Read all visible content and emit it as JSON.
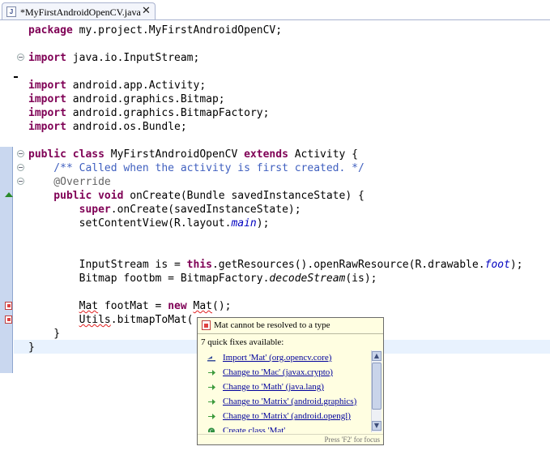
{
  "tab": {
    "title": "*MyFirstAndroidOpenCV.java",
    "close_glyph": "✕"
  },
  "code": {
    "l1": {
      "kw": "package",
      "rest": " my.project.MyFirstAndroidOpenCV;"
    },
    "l2": {
      "kw": "import",
      "rest": " java.io.InputStream;"
    },
    "l3": {
      "kw": "import",
      "rest": " android.app.Activity;"
    },
    "l4": {
      "kw": "import",
      "rest": " android.graphics.Bitmap;"
    },
    "l5": {
      "kw": "import",
      "rest": " android.graphics.BitmapFactory;"
    },
    "l6": {
      "kw": "import",
      "rest": " android.os.Bundle;"
    },
    "l7": {
      "kw1": "public class",
      "mid": " MyFirstAndroidOpenCV ",
      "kw2": "extends",
      "rest": " Activity {"
    },
    "l8": {
      "comment": "    /** Called when the activity is first created. */"
    },
    "l9": {
      "annotation": "    @Override"
    },
    "l10": {
      "kw": "    public void",
      "rest": " onCreate(Bundle savedInstanceState) {"
    },
    "l11": {
      "kw": "        super",
      "rest": ".onCreate(savedInstanceState);"
    },
    "l12": {
      "pre": "        setContentView(R.layout.",
      "field": "main",
      "post": ");"
    },
    "l13": {
      "pre": "        InputStream is = ",
      "kw": "this",
      "mid": ".getResources().openRawResource(R.drawable.",
      "field": "foot",
      "post": ");"
    },
    "l14": {
      "pre": "        Bitmap footbm = BitmapFactory.",
      "method": "decodeStream",
      "post": "(is);"
    },
    "l15": {
      "pre": "        ",
      "err1": "Mat",
      "mid": " footMat = ",
      "kw": "new",
      "sp": " ",
      "err2": "Mat",
      "post": "();"
    },
    "l16": {
      "pre": "        ",
      "err": "Utils",
      "post": ".bitmapToMat("
    },
    "l17": {
      "text": "    }"
    },
    "l18": {
      "text": "}"
    }
  },
  "popup": {
    "message": "Mat cannot be resolved to a type",
    "count": "7 quick fixes available:",
    "fixes": [
      {
        "label": "Import 'Mat' (org.opencv.core)",
        "icon": "import-icon"
      },
      {
        "label": "Change to 'Mac' (javax.crypto)",
        "icon": "change-arrow-icon"
      },
      {
        "label": "Change to 'Math' (java.lang)",
        "icon": "change-arrow-icon"
      },
      {
        "label": "Change to 'Matrix' (android.graphics)",
        "icon": "change-arrow-icon"
      },
      {
        "label": "Change to 'Matrix' (android.opengl)",
        "icon": "change-arrow-icon"
      },
      {
        "label": "Create class 'Mat'",
        "icon": "create-class-icon"
      }
    ],
    "hint": "Press 'F2' for focus",
    "scroll_up": "▲",
    "scroll_down": "▼"
  }
}
